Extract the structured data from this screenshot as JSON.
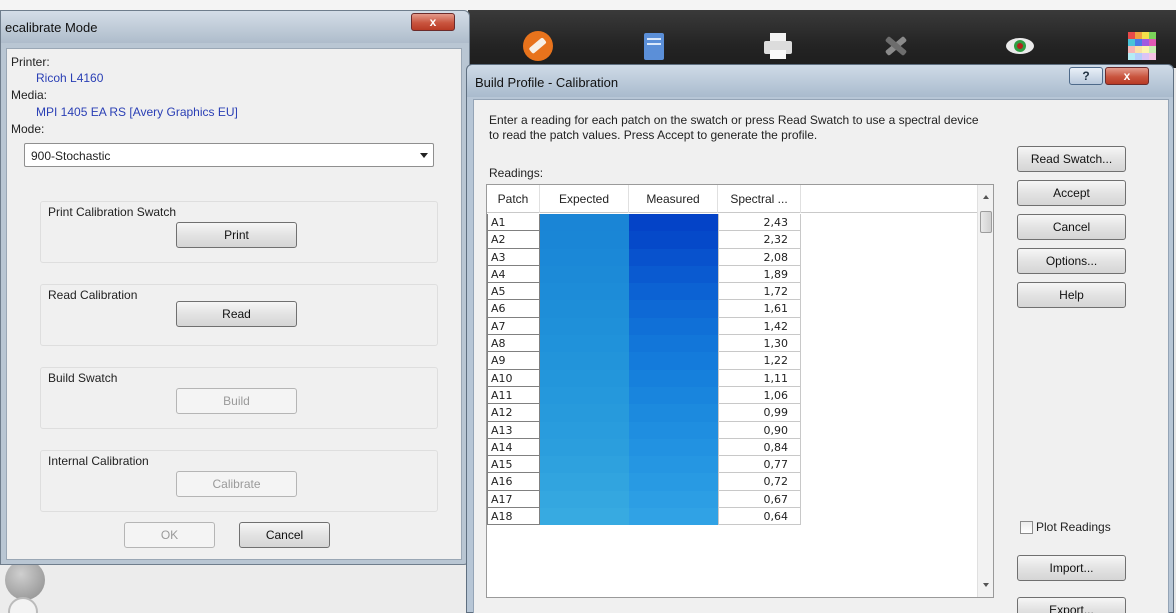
{
  "background": {
    "toolbar_icons": [
      "brush-icon",
      "document-icon",
      "printer-icon",
      "tools-icon",
      "eye-icon",
      "color-palette-icon"
    ]
  },
  "recalibrate": {
    "title": "ecalibrate Mode",
    "close": "x",
    "printer_label": "Printer:",
    "printer_value": "Ricoh L4160",
    "media_label": "Media:",
    "media_value": "MPI 1405 EA RS [Avery Graphics EU]",
    "mode_label": "Mode:",
    "mode_value": "900-Stochastic",
    "groups": [
      {
        "label": "Print Calibration Swatch",
        "button": "Print",
        "enabled": true
      },
      {
        "label": "Read Calibration",
        "button": "Read",
        "enabled": true
      },
      {
        "label": "Build Swatch",
        "button": "Build",
        "enabled": false
      },
      {
        "label": "Internal Calibration",
        "button": "Calibrate",
        "enabled": false
      }
    ],
    "ok": "OK",
    "cancel": "Cancel"
  },
  "build_profile": {
    "title": "Build Profile - Calibration",
    "help_glyph": "?",
    "close": "x",
    "instructions": "Enter a reading for each patch on the swatch or press Read Swatch to use a spectral device to read the patch values. Press Accept to generate the profile.",
    "readings_label": "Readings:",
    "columns": [
      "Patch",
      "Expected",
      "Measured",
      "Spectral ..."
    ],
    "rows": [
      {
        "patch": "A1",
        "spectral": "2,43",
        "expected": "#1a85d6",
        "measured": "#0443c7"
      },
      {
        "patch": "A2",
        "spectral": "2,32",
        "expected": "#1a86d6",
        "measured": "#0549c9"
      },
      {
        "patch": "A3",
        "spectral": "2,08",
        "expected": "#1b88d7",
        "measured": "#0852cd"
      },
      {
        "patch": "A4",
        "spectral": "1,89",
        "expected": "#1c8ad7",
        "measured": "#0a5ad0"
      },
      {
        "patch": "A5",
        "spectral": "1,72",
        "expected": "#1d8cd8",
        "measured": "#0c62d3"
      },
      {
        "patch": "A6",
        "spectral": "1,61",
        "expected": "#1e8ed8",
        "measured": "#0e69d5"
      },
      {
        "patch": "A7",
        "spectral": "1,42",
        "expected": "#1f90d9",
        "measured": "#1070d7"
      },
      {
        "patch": "A8",
        "spectral": "1,30",
        "expected": "#2092da",
        "measured": "#1276d9"
      },
      {
        "patch": "A9",
        "spectral": "1,22",
        "expected": "#2294da",
        "measured": "#147bdb"
      },
      {
        "patch": "A10",
        "spectral": "1,11",
        "expected": "#2396db",
        "measured": "#1680dc"
      },
      {
        "patch": "A11",
        "spectral": "1,06",
        "expected": "#2598dc",
        "measured": "#1985dd"
      },
      {
        "patch": "A12",
        "spectral": "0,99",
        "expected": "#279adc",
        "measured": "#1c8ade"
      },
      {
        "patch": "A13",
        "spectral": "0,90",
        "expected": "#299cdd",
        "measured": "#1f8ee0"
      },
      {
        "patch": "A14",
        "spectral": "0,84",
        "expected": "#2b9edd",
        "measured": "#2292e1"
      },
      {
        "patch": "A15",
        "spectral": "0,77",
        "expected": "#2ea1de",
        "measured": "#2596e2"
      },
      {
        "patch": "A16",
        "spectral": "0,72",
        "expected": "#31a4df",
        "measured": "#289ae3"
      },
      {
        "patch": "A17",
        "spectral": "0,67",
        "expected": "#34a7e0",
        "measured": "#2c9ee4"
      },
      {
        "patch": "A18",
        "spectral": "0,64",
        "expected": "#37aae1",
        "measured": "#30a2e5"
      }
    ],
    "buttons": {
      "read_swatch": "Read Swatch...",
      "accept": "Accept",
      "cancel": "Cancel",
      "options": "Options...",
      "help": "Help",
      "import": "Import...",
      "export": "Export..."
    },
    "plot_readings": "Plot Readings"
  }
}
